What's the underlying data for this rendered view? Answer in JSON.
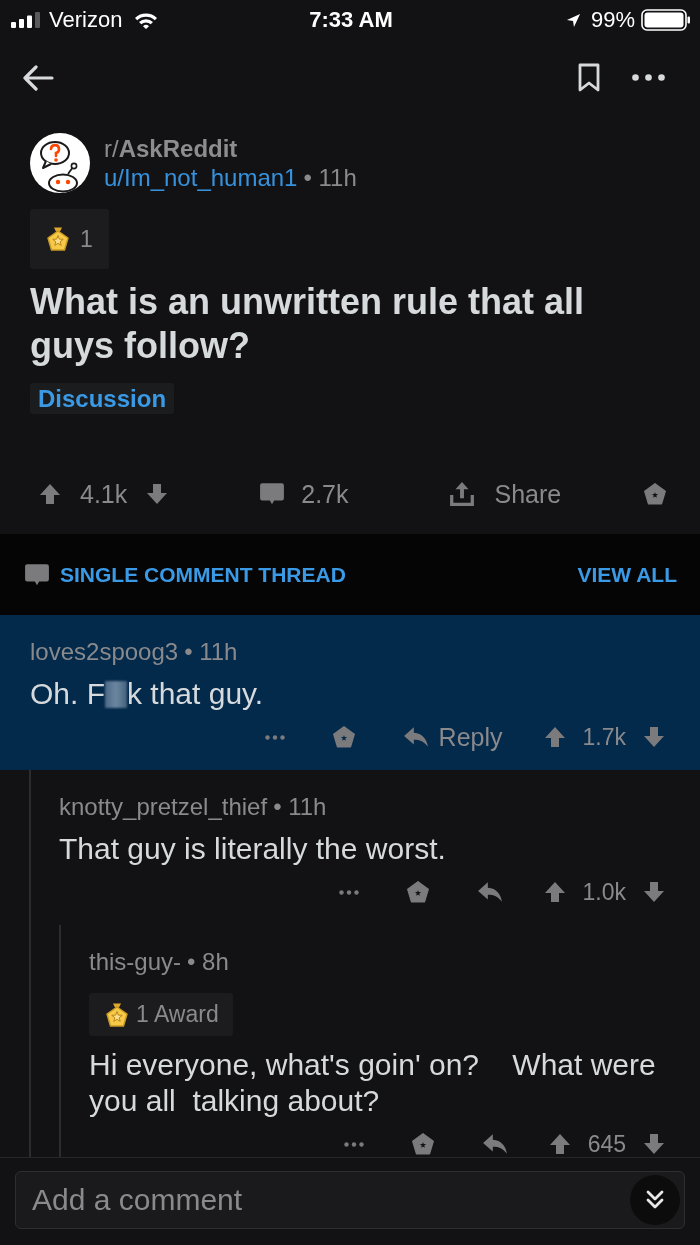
{
  "status_bar": {
    "carrier": "Verizon",
    "time": "7:33 AM",
    "battery": "99%"
  },
  "post": {
    "subreddit": "r/**AskReddit**",
    "author": "u/Im_not_human1",
    "meta": "• 11h",
    "award_count": "1",
    "title": "What is an unwritten rule that all guys follow?",
    "flair": "Discussion",
    "score": "4.1k",
    "comments": "2.7k",
    "share": "Share"
  },
  "thread_bar": {
    "label": "SINGLE COMMENT THREAD",
    "view_all": "VIEW ALL"
  },
  "comments": [
    {
      "author": "loves2spoog3",
      "meta": "• 11h",
      "highlighted": true,
      "body": [
        {
          "kind": "text",
          "text": "Oh. F"
        },
        {
          "kind": "censor"
        },
        {
          "kind": "text",
          "text": "k that guy."
        }
      ],
      "reply_label": "Reply",
      "score": "1.7k",
      "children": [
        {
          "author": "knotty_pretzel_thief",
          "meta": "• 11h",
          "highlighted": false,
          "body": [
            {
              "kind": "text",
              "text": "That guy is literally the worst."
            }
          ],
          "score": "1.0k",
          "children": [
            {
              "author": "this-guy-",
              "meta": "• 8h",
              "highlighted": false,
              "award_label": "1 Award",
              "body": [
                {
                  "kind": "text",
                  "text": "Hi everyone, what's goin' on?    What were you all  talking about?"
                }
              ],
              "score": "645"
            }
          ]
        }
      ]
    }
  ],
  "composer": {
    "placeholder": "Add a comment"
  }
}
